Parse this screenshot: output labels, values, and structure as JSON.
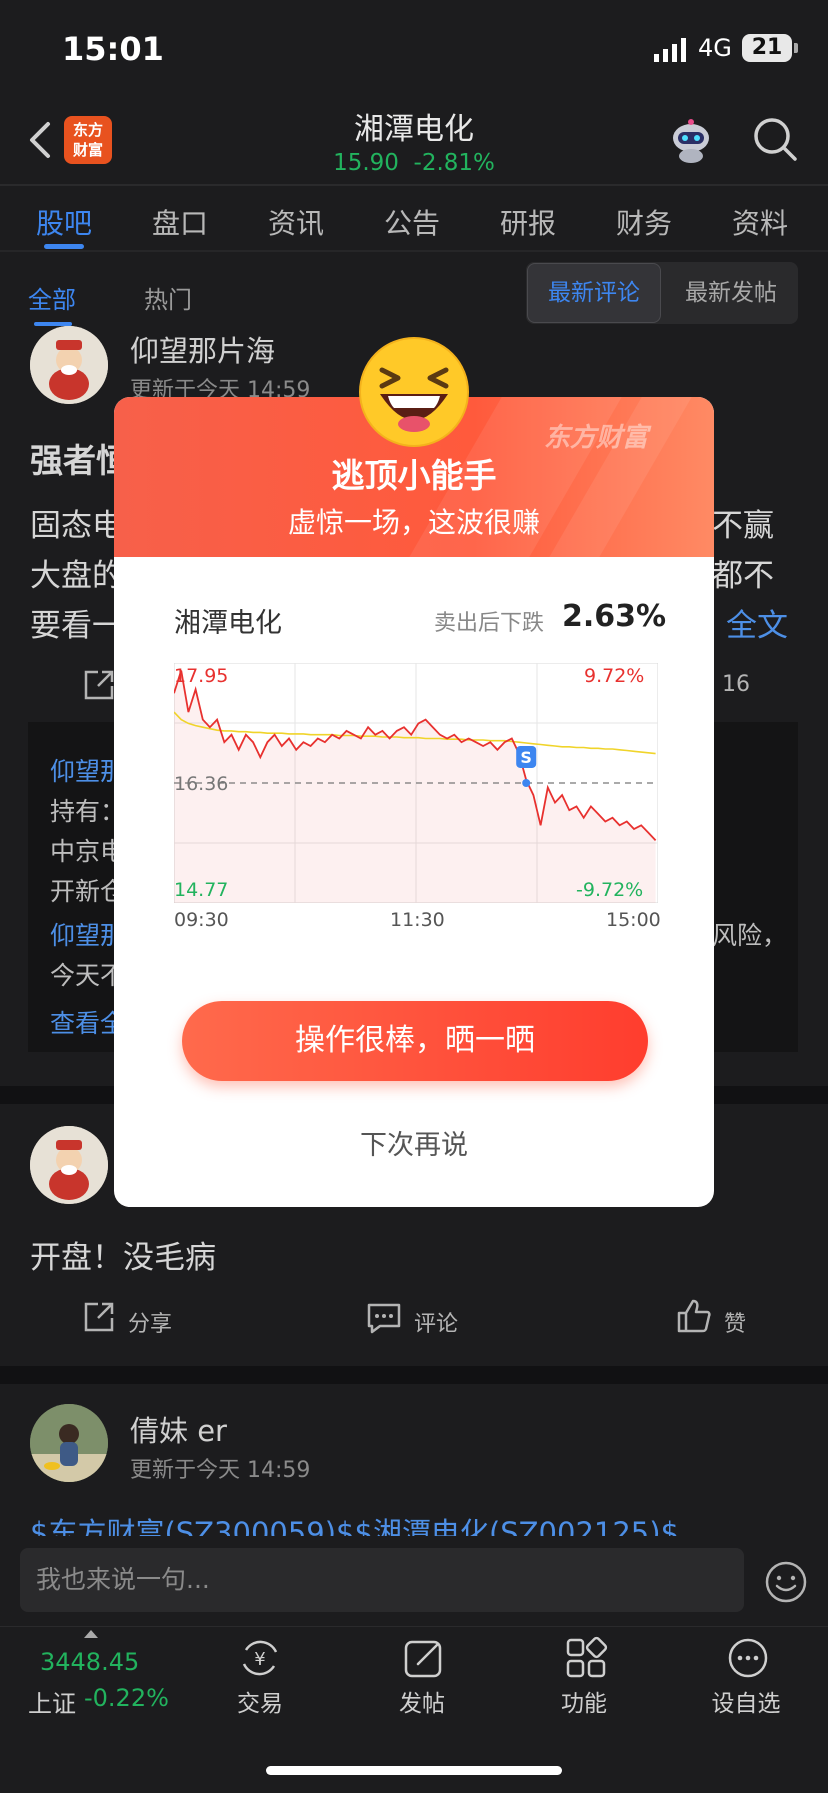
{
  "status_bar": {
    "time": "15:01",
    "network": "4G",
    "battery": "21"
  },
  "header": {
    "logo_text_line1": "东方",
    "logo_text_line2": "财富",
    "stock_name": "湘潭电化",
    "price_line": "15.90  -2.81%"
  },
  "tabs": [
    {
      "label": "股吧",
      "active": true
    },
    {
      "label": "盘口"
    },
    {
      "label": "资讯"
    },
    {
      "label": "公告"
    },
    {
      "label": "研报"
    },
    {
      "label": "财务"
    },
    {
      "label": "资料"
    }
  ],
  "filters": {
    "all": "全部",
    "hot": "热门",
    "latest_comment": "最新评论",
    "latest_post": "最新发帖"
  },
  "posts": [
    {
      "username": "仰望那片海",
      "updated": "更新于今天 14:59",
      "title": "强者恒",
      "line1a": "固态电",
      "line1b": "不赢",
      "line2a": "大盘的",
      "line2b": "都不",
      "line3a": "要看一",
      "full_text": "全文",
      "count": "16",
      "quote": {
        "l1": "仰望那",
        "l2": "持有：",
        "l3": "中京电",
        "l4": "开新仓",
        "l5a": "仰望那",
        "l5b": "风险，",
        "l6": "今天不",
        "l7": "查看全"
      }
    },
    {
      "text": "开盘！没毛病",
      "share": "分享",
      "comment": "评论",
      "like": "赞"
    },
    {
      "username": "倩妹 er",
      "updated": "更新于今天 14:59",
      "tags": "$东方财富(SZ300059)$$湘潭电化(SZ002125)$"
    }
  ],
  "modal": {
    "brand": "东方财富",
    "title": "逃顶小能手",
    "subtitle": "虚惊一场，这波很赚",
    "stock": "湘潭电化",
    "fall_label": "卖出后下跌",
    "fall_value": "2.63%",
    "share_button": "操作很棒，晒一晒",
    "later_button": "下次再说"
  },
  "chart_data": {
    "type": "line",
    "ylim": [
      14.77,
      17.95
    ],
    "y_ticks_left": [
      "17.95",
      "16.36",
      "14.77"
    ],
    "y_ticks_right": [
      "9.72%",
      "-9.72%"
    ],
    "x_ticks": [
      "09:30",
      "11:30",
      "15:00"
    ],
    "reference_price": 16.36,
    "sell_marker": "S",
    "series": [
      {
        "values": [
          17.55,
          17.85,
          17.3,
          17.6,
          17.2,
          17.1,
          17.2,
          16.9,
          17.0,
          16.8,
          17.0,
          16.9,
          16.7,
          16.9,
          17.0,
          16.85,
          16.95,
          16.8,
          16.9,
          16.85,
          16.95,
          16.9,
          17.0,
          16.95,
          17.05,
          17.0,
          16.95,
          17.1,
          17.0,
          17.05,
          16.95,
          17.05,
          17.1,
          17.0,
          17.15,
          17.2,
          17.1,
          17.0,
          16.95,
          17.0,
          16.9,
          16.95,
          16.9,
          16.85,
          16.9,
          16.8,
          16.9,
          16.95,
          16.75,
          16.4,
          16.2,
          15.8,
          16.3,
          16.1,
          16.2,
          16.0,
          16.05,
          15.9,
          16.05,
          15.95,
          15.85,
          15.9,
          15.8,
          15.85,
          15.75,
          15.8,
          15.7,
          15.6
        ]
      },
      {
        "values": [
          17.3,
          17.2,
          17.15,
          17.12,
          17.1,
          17.08,
          17.06,
          17.05,
          17.05,
          17.04,
          17.04,
          17.03,
          17.03,
          17.02,
          17.02,
          17.02,
          17.01,
          17.01,
          17.01,
          17.0,
          17.0,
          17.0,
          17.0,
          16.99,
          16.99,
          16.99,
          16.98,
          16.98,
          16.98,
          16.97,
          16.97,
          16.97,
          16.96,
          16.96,
          16.96,
          16.95,
          16.95,
          16.95,
          16.94,
          16.94,
          16.94,
          16.93,
          16.93,
          16.93,
          16.92,
          16.92,
          16.92,
          16.91,
          16.9,
          16.89,
          16.88,
          16.87,
          16.86,
          16.85,
          16.84,
          16.84,
          16.83,
          16.83,
          16.82,
          16.82,
          16.81,
          16.81,
          16.8,
          16.79,
          16.78,
          16.77,
          16.76,
          16.75
        ]
      }
    ],
    "sell_index": 49
  },
  "comment_input": {
    "placeholder": "我也来说一句..."
  },
  "bottom_nav": {
    "index_value": "3448.45",
    "index_name": "上证",
    "index_pct": "-0.22%",
    "items": [
      "交易",
      "发帖",
      "功能",
      "设自选"
    ]
  },
  "colors": {
    "accent": "#3d86f0",
    "up": "#e8312f",
    "down": "#22b35e",
    "modal_red": "#ff5a3c"
  }
}
